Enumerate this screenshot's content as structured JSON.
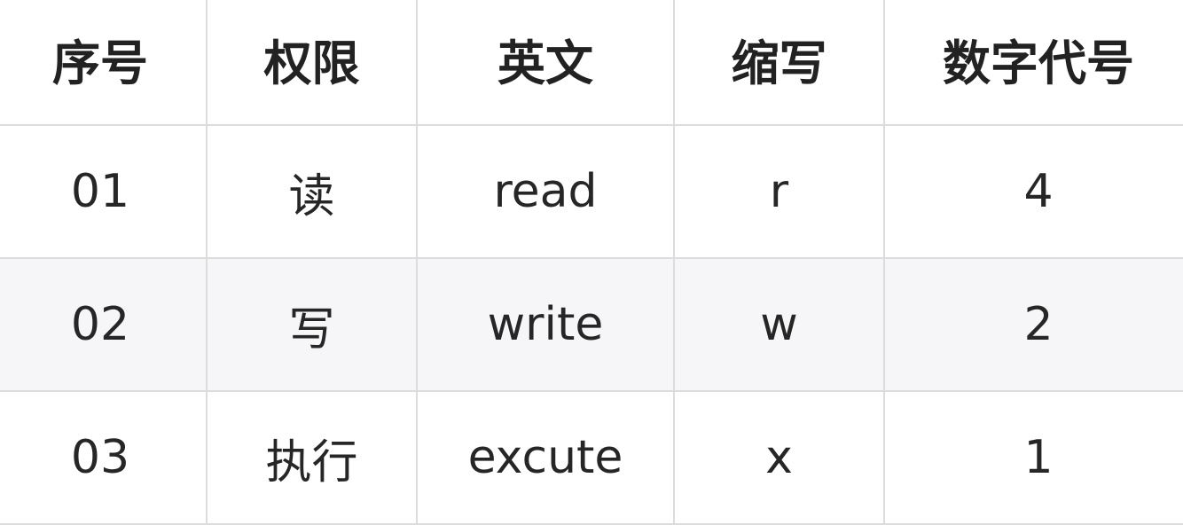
{
  "table": {
    "headers": [
      "序号",
      "权限",
      "英文",
      "缩写",
      "数字代号"
    ],
    "rows": [
      [
        "01",
        "读",
        "read",
        "r",
        "4"
      ],
      [
        "02",
        "写",
        "write",
        "w",
        "2"
      ],
      [
        "03",
        "执行",
        "excute",
        "x",
        "1"
      ]
    ]
  }
}
